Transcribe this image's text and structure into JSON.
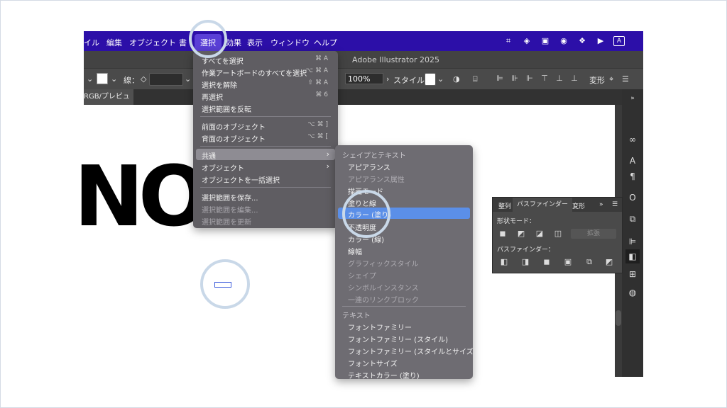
{
  "menubar": {
    "items": [
      "イル",
      "編集",
      "オブジェクト",
      "書",
      "選択",
      "効果",
      "表示",
      "ウィンドウ",
      "ヘルプ"
    ],
    "selected": "選択",
    "icons": [
      "extension-icon",
      "cc-icon",
      "app-icon",
      "creative-icon",
      "dropbox-icon",
      "play-icon",
      "a-icon"
    ],
    "a_glyph": "A"
  },
  "titlebar": {
    "title": "Adobe Illustrator 2025"
  },
  "controlbar": {
    "stroke_label": "線：",
    "zoom": "100%",
    "style_label": "スタイル：",
    "transform_label": "変形"
  },
  "doc_tab": {
    "label": "RGB/プレビュー)"
  },
  "canvas": {
    "artwork_text": "NOIS"
  },
  "select_menu": {
    "items": [
      {
        "label": "すべてを選択",
        "shortcut": "⌘ A",
        "disabled": false
      },
      {
        "label": "作業アートボードのすべてを選択",
        "shortcut": "⌥ ⌘ A",
        "disabled": false
      },
      {
        "label": "選択を解除",
        "shortcut": "⇧ ⌘ A",
        "disabled": false
      },
      {
        "label": "再選択",
        "shortcut": "⌘ 6",
        "disabled": false
      },
      {
        "label": "選択範囲を反転",
        "shortcut": "",
        "disabled": false
      },
      {
        "label": "前面のオブジェクト",
        "shortcut": "⌥ ⌘ ]",
        "disabled": false
      },
      {
        "label": "背面のオブジェクト",
        "shortcut": "⌥ ⌘ [",
        "disabled": false
      },
      {
        "label": "共通",
        "shortcut": "",
        "disabled": false,
        "submenu": true,
        "highlighted": true
      },
      {
        "label": "オブジェクト",
        "shortcut": "",
        "disabled": false,
        "submenu": true
      },
      {
        "label": "オブジェクトを一括選択",
        "shortcut": "",
        "disabled": false
      },
      {
        "label": "選択範囲を保存...",
        "shortcut": "",
        "disabled": false
      },
      {
        "label": "選択範囲を編集...",
        "shortcut": "",
        "disabled": true
      },
      {
        "label": "選択範囲を更新",
        "shortcut": "",
        "disabled": true
      }
    ]
  },
  "same_submenu": {
    "header_shape": "シェイプとテキスト",
    "items_shape": [
      {
        "label": "アピアランス",
        "disabled": false
      },
      {
        "label": "アピアランス属性",
        "disabled": true
      },
      {
        "label": "描画モード",
        "disabled": false
      },
      {
        "label": "塗りと線",
        "disabled": false
      },
      {
        "label": "カラー (塗り)",
        "disabled": false,
        "highlighted": true
      },
      {
        "label": "不透明度",
        "disabled": false
      },
      {
        "label": "カラー (線)",
        "disabled": false
      },
      {
        "label": "線幅",
        "disabled": false
      },
      {
        "label": "グラフィックスタイル",
        "disabled": true
      },
      {
        "label": "シェイプ",
        "disabled": true
      },
      {
        "label": "シンボルインスタンス",
        "disabled": true
      },
      {
        "label": "一連のリンクブロック",
        "disabled": true
      }
    ],
    "header_text": "テキスト",
    "items_text": [
      {
        "label": "フォントファミリー",
        "disabled": false
      },
      {
        "label": "フォントファミリー (スタイル)",
        "disabled": false
      },
      {
        "label": "フォントファミリー (スタイルとサイズ)",
        "disabled": false
      },
      {
        "label": "フォントサイズ",
        "disabled": false
      },
      {
        "label": "テキストカラー (塗り)",
        "disabled": false
      }
    ]
  },
  "pathfinder_panel": {
    "tabs": [
      "整列",
      "パスファインダー",
      "変形"
    ],
    "active_tab": "パスファインダー",
    "shape_modes_label": "形状モード：",
    "expand_label": "拡張",
    "pathfinders_label": "パスファインダー："
  },
  "colors": {
    "menubar": "#2c0fa8",
    "menu_bg": "#5f5d62",
    "submenu_bg": "#6e6c72",
    "highlight": "#5b8fe8",
    "ring": "#c9d8e8"
  }
}
